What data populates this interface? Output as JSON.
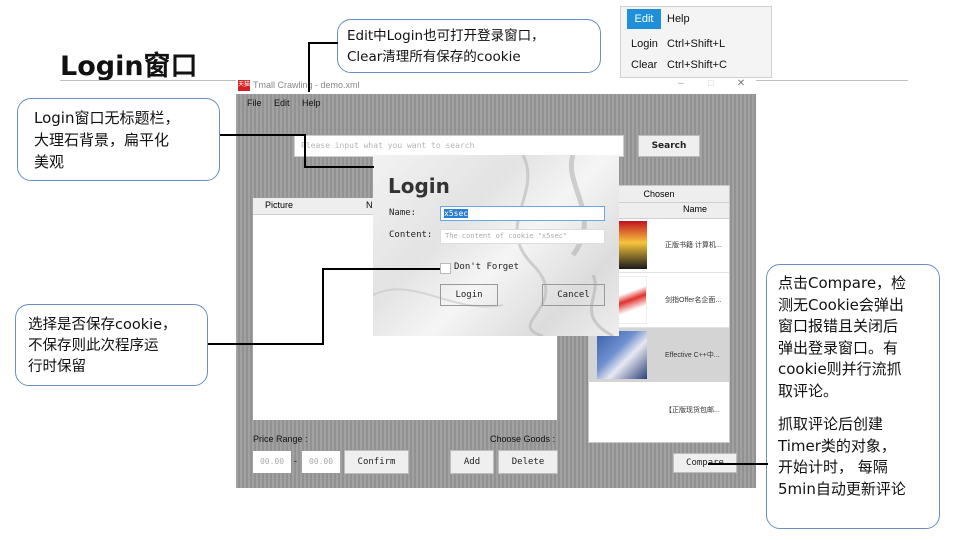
{
  "slide": {
    "title": "Login窗口"
  },
  "callouts": {
    "top": [
      "Edit中Login也可打开登录窗口，",
      "Clear清理所有保存的cookie"
    ],
    "left_top": [
      "Login窗口无标题栏，",
      "大理石背景，扁平化",
      "美观"
    ],
    "left_bottom": [
      "选择是否保存cookie，",
      "不保存则此次程序运",
      "行时保留"
    ],
    "right": [
      "点击Compare，检",
      "测无Cookie会弹出",
      "窗口报错且关闭后",
      "弹出登录窗口。有",
      "cookie则并行流抓",
      "取评论。",
      "",
      "抓取评论后创建",
      "Timer类的对象，",
      "开始计时， 每隔",
      "5min自动更新评论"
    ]
  },
  "edit_menu": {
    "tabs": [
      "Edit",
      "Help"
    ],
    "items": [
      {
        "label": "Login",
        "shortcut": "Ctrl+Shift+L"
      },
      {
        "label": "Clear",
        "shortcut": "Ctrl+Shift+C"
      }
    ]
  },
  "app": {
    "window_title": "Tmall Crawling - demo.xml",
    "icon_text": "天猫",
    "menu": [
      "File",
      "Edit",
      "Help"
    ],
    "search_placeholder": "Please input what you want to search",
    "search_button": "Search",
    "left_table_headers": [
      "Picture",
      "N"
    ],
    "chosen": {
      "title": "Chosen",
      "headers": [
        "cture",
        "Name"
      ],
      "rows": [
        "正版书籍 计算机...",
        "剑指Offer名企面...",
        "Effective C++中...",
        "【正版现货包邮..."
      ]
    },
    "price_range_label": "Price Range :",
    "price_from": "00.00",
    "price_sep": "-",
    "price_to": "00.00",
    "confirm_button": "Confirm",
    "choose_goods_label": "Choose Goods :",
    "add_button": "Add",
    "delete_button": "Delete",
    "compare_button": "Compare",
    "login": {
      "title": "Login",
      "name_label": "Name:",
      "name_value": "x5sec",
      "content_label": "Content:",
      "content_placeholder": "The content of cookie \"x5sec\"",
      "remember_label": "Don't Forget",
      "login_button": "Login",
      "cancel_button": "Cancel"
    }
  },
  "colors": {
    "callout_border": "#6b8fc2",
    "menu_highlight": "#1e8fd8",
    "selected_row": "#d4d4d4"
  }
}
